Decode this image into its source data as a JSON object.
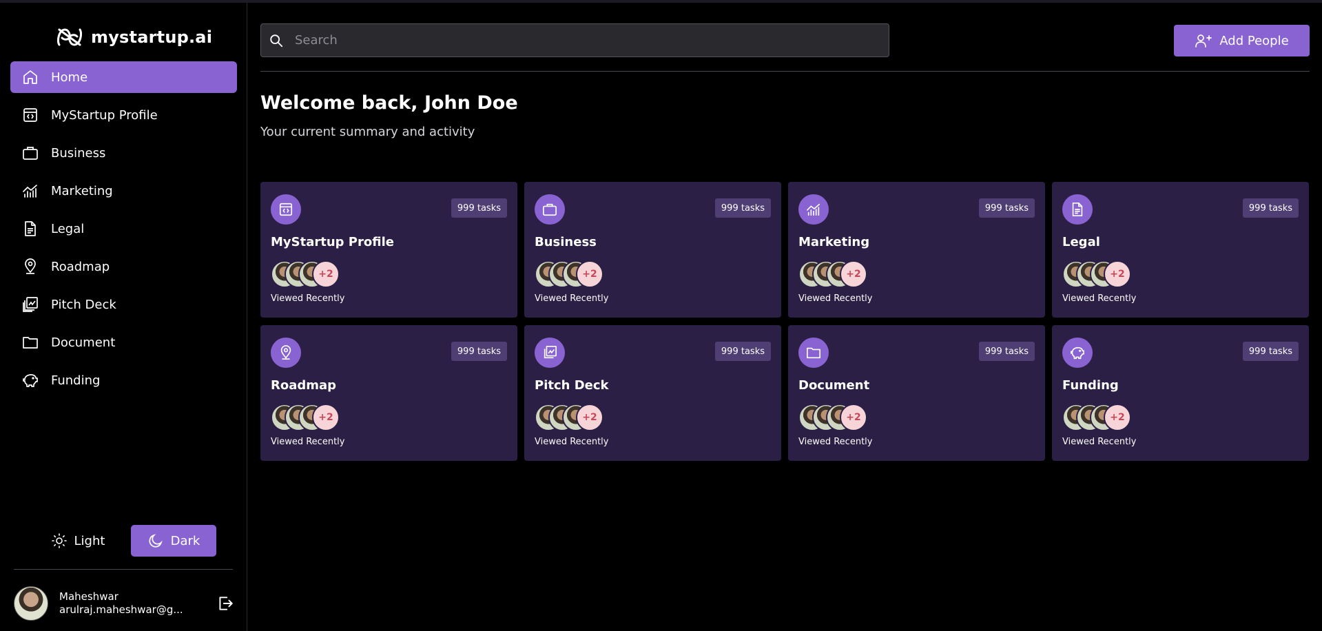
{
  "brand": {
    "name": "mystartup.ai"
  },
  "sidebar": {
    "items": [
      {
        "label": "Home",
        "icon": "home-icon",
        "active": true
      },
      {
        "label": "MyStartup Profile",
        "icon": "code-window-icon",
        "active": false
      },
      {
        "label": "Business",
        "icon": "briefcase-icon",
        "active": false
      },
      {
        "label": "Marketing",
        "icon": "chart-line-icon",
        "active": false
      },
      {
        "label": "Legal",
        "icon": "document-icon",
        "active": false
      },
      {
        "label": "Roadmap",
        "icon": "map-pin-icon",
        "active": false
      },
      {
        "label": "Pitch Deck",
        "icon": "presentation-icon",
        "active": false
      },
      {
        "label": "Document",
        "icon": "folder-icon",
        "active": false
      },
      {
        "label": "Funding",
        "icon": "piggy-bank-icon",
        "active": false
      }
    ],
    "theme": {
      "light_label": "Light",
      "dark_label": "Dark",
      "selected": "Dark"
    },
    "user": {
      "name": "Maheshwar",
      "email": "arulraj.maheshwar@g..."
    }
  },
  "header": {
    "search_placeholder": "Search",
    "add_people_label": "Add People"
  },
  "main": {
    "welcome": "Welcome back, John Doe",
    "subtitle": "Your current summary and activity",
    "cards": [
      {
        "title": "MyStartup Profile",
        "tasks": "999 tasks",
        "more": "+2",
        "viewed": "Viewed Recently",
        "icon": "code-window-icon"
      },
      {
        "title": "Business",
        "tasks": "999 tasks",
        "more": "+2",
        "viewed": "Viewed Recently",
        "icon": "briefcase-icon"
      },
      {
        "title": "Marketing",
        "tasks": "999 tasks",
        "more": "+2",
        "viewed": "Viewed Recently",
        "icon": "chart-line-icon"
      },
      {
        "title": "Legal",
        "tasks": "999 tasks",
        "more": "+2",
        "viewed": "Viewed Recently",
        "icon": "document-icon"
      },
      {
        "title": "Roadmap",
        "tasks": "999 tasks",
        "more": "+2",
        "viewed": "Viewed Recently",
        "icon": "map-pin-icon"
      },
      {
        "title": "Pitch Deck",
        "tasks": "999 tasks",
        "more": "+2",
        "viewed": "Viewed Recently",
        "icon": "presentation-icon"
      },
      {
        "title": "Document",
        "tasks": "999 tasks",
        "more": "+2",
        "viewed": "Viewed Recently",
        "icon": "folder-icon"
      },
      {
        "title": "Funding",
        "tasks": "999 tasks",
        "more": "+2",
        "viewed": "Viewed Recently",
        "icon": "piggy-bank-icon"
      }
    ]
  },
  "colors": {
    "accent": "#8a63d2",
    "card_bg": "#2b1f45",
    "badge_bg": "#4e3e74",
    "background": "#000000"
  }
}
